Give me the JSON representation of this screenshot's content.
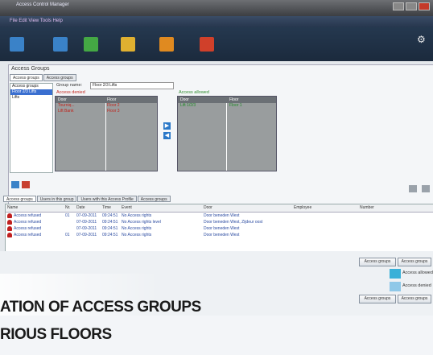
{
  "window": {
    "title": "Access Control Manager",
    "menu": "File  Edit  View  Tools  Help"
  },
  "toolbar": {
    "buttons": [
      {
        "name": "users-icon",
        "color": "#3a82c8"
      },
      {
        "name": "doors-icon",
        "color": "#3a82c8"
      },
      {
        "name": "exit-icon",
        "color": "#44a844"
      },
      {
        "name": "groups-icon",
        "color": "#e0b030"
      },
      {
        "name": "reports-icon",
        "color": "#e08a20"
      },
      {
        "name": "alarm-icon",
        "color": "#d0402a"
      }
    ]
  },
  "panel": {
    "title": "Access Groups",
    "tabs": [
      "Access groups",
      "Access groups"
    ]
  },
  "left_list": [
    "Access groups",
    "Floor 2/3 Lifts",
    "Lifts"
  ],
  "form": {
    "name_label": "Group name:",
    "name_value": "Floor 2/3 Lifts",
    "denied_title": "Access denied",
    "allowed_title": "Access allowed"
  },
  "denied_grid": {
    "headers": [
      "Door",
      "Floor"
    ],
    "rows": [
      [
        "Tourniq...",
        "Floor 2"
      ],
      [
        "Lift Bank",
        "Floor 3"
      ]
    ]
  },
  "allowed_grid": {
    "headers": [
      "Door",
      "Floor"
    ],
    "rows": [
      [
        "Lift 1/2/3",
        "Floor 1"
      ]
    ]
  },
  "arrows": {
    "right": "▶",
    "left": "◀"
  },
  "lower_tabs": [
    "Access groups",
    "Users in this group",
    "Users with this Access Profile",
    "Access groups"
  ],
  "events_table": {
    "headers": [
      "Name",
      "Nr.",
      "Date",
      "Time",
      "Event",
      "Door",
      "Employee",
      "Number"
    ],
    "rows": [
      [
        "Access refused",
        "01",
        "07-09-2011",
        "09:24:51",
        "No Access rights",
        "Door beneden West",
        "",
        ""
      ],
      [
        "Access refused",
        "",
        "07-09-2011",
        "09:24:51",
        "No Access rights level",
        "Door beneden West, Zijdeur oost",
        "",
        ""
      ],
      [
        "Access refused",
        "",
        "07-09-2011",
        "09:24:51",
        "No Access rights",
        "Door beneden West",
        "",
        ""
      ],
      [
        "Access refused",
        "01",
        "07-09-2011",
        "09:24:51",
        "No Access rights",
        "Door beneden West",
        "",
        ""
      ]
    ]
  },
  "bottom_buttons": {
    "btn1": "Access groups",
    "btn2": "Access groups",
    "btn3": "Access groups",
    "btn4": "Access groups"
  },
  "legend": {
    "item1": "Access allowed",
    "item2": "Access denied"
  },
  "caption": {
    "line1": "ATION OF ACCESS GROUPS",
    "line2": "RIOUS FLOORS"
  }
}
